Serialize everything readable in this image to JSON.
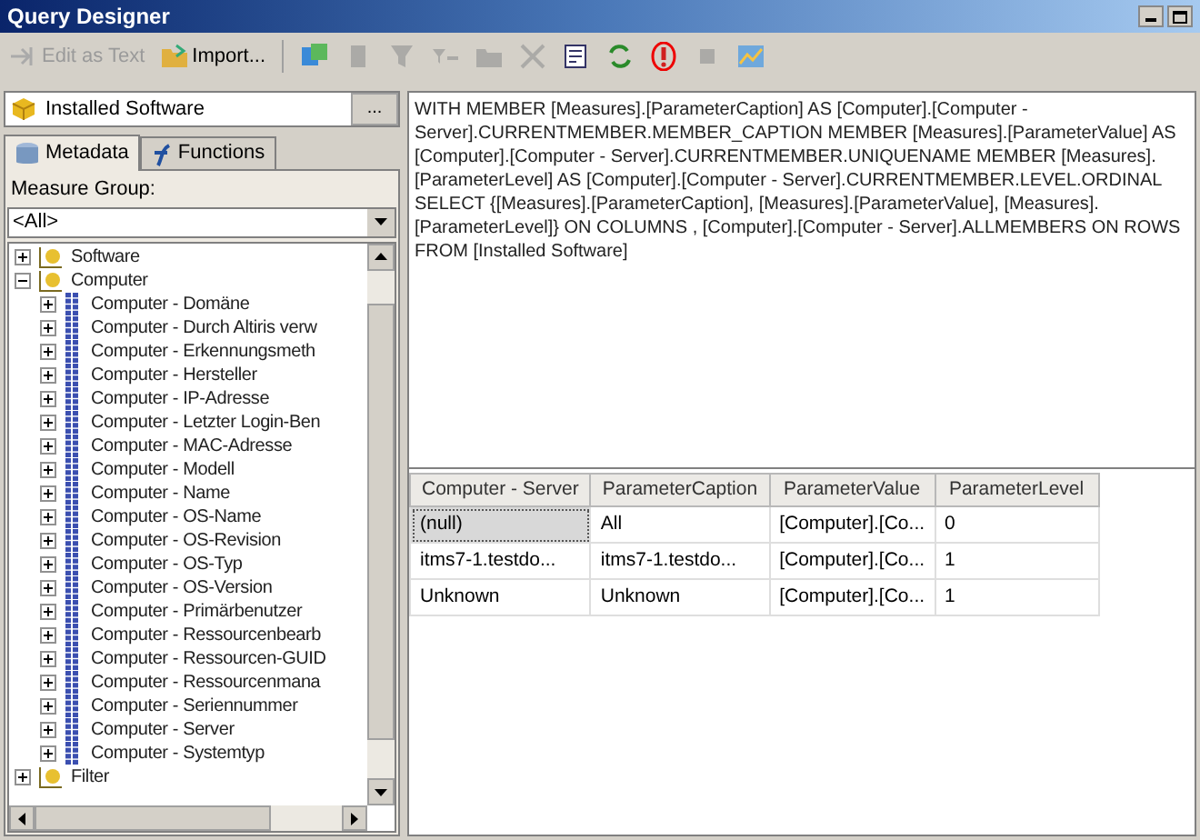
{
  "window": {
    "title": "Query Designer"
  },
  "toolbar": {
    "text_buttons": [
      {
        "kind": "edit",
        "label": "Edit as Text",
        "disabled": true
      },
      {
        "kind": "import",
        "label": "Import...",
        "disabled": false
      }
    ],
    "icon_buttons": [
      {
        "kind": "add-calc",
        "disabled": false
      },
      {
        "kind": "doc",
        "disabled": true
      },
      {
        "kind": "filter",
        "disabled": true
      },
      {
        "kind": "filter2",
        "disabled": true
      },
      {
        "kind": "folder",
        "disabled": true
      },
      {
        "kind": "delete",
        "disabled": true
      },
      {
        "kind": "params",
        "disabled": false
      },
      {
        "kind": "refresh",
        "disabled": false
      },
      {
        "kind": "run",
        "disabled": false
      },
      {
        "kind": "stop",
        "disabled": true
      },
      {
        "kind": "chart",
        "disabled": false
      }
    ]
  },
  "cube": {
    "name": "Installed Software",
    "button": "..."
  },
  "tabs": [
    {
      "label": "Metadata",
      "selected": true
    },
    {
      "label": "Functions",
      "selected": false
    }
  ],
  "measure_group": {
    "label": "Measure Group:",
    "value": "<All>"
  },
  "tree": [
    {
      "label": "Software",
      "kind": "dimension",
      "expanded": false
    },
    {
      "label": "Computer",
      "kind": "dimension",
      "expanded": true,
      "children": [
        {
          "label": "Computer - Domäne",
          "kind": "hierarchy",
          "expanded": false
        },
        {
          "label": "Computer - Durch Altiris verw",
          "kind": "hierarchy",
          "expanded": false
        },
        {
          "label": "Computer - Erkennungsmeth",
          "kind": "hierarchy",
          "expanded": false
        },
        {
          "label": "Computer - Hersteller",
          "kind": "hierarchy",
          "expanded": false
        },
        {
          "label": "Computer - IP-Adresse",
          "kind": "hierarchy",
          "expanded": false
        },
        {
          "label": "Computer - Letzter Login-Ben",
          "kind": "hierarchy",
          "expanded": false
        },
        {
          "label": "Computer - MAC-Adresse",
          "kind": "hierarchy",
          "expanded": false
        },
        {
          "label": "Computer - Modell",
          "kind": "hierarchy",
          "expanded": false
        },
        {
          "label": "Computer - Name",
          "kind": "hierarchy",
          "expanded": false
        },
        {
          "label": "Computer - OS-Name",
          "kind": "hierarchy",
          "expanded": false
        },
        {
          "label": "Computer - OS-Revision",
          "kind": "hierarchy",
          "expanded": false
        },
        {
          "label": "Computer - OS-Typ",
          "kind": "hierarchy",
          "expanded": false
        },
        {
          "label": "Computer - OS-Version",
          "kind": "hierarchy",
          "expanded": false
        },
        {
          "label": "Computer - Primärbenutzer",
          "kind": "hierarchy",
          "expanded": false
        },
        {
          "label": "Computer - Ressourcenbearb",
          "kind": "hierarchy",
          "expanded": false
        },
        {
          "label": "Computer - Ressourcen-GUID",
          "kind": "hierarchy",
          "expanded": false
        },
        {
          "label": "Computer - Ressourcenmana",
          "kind": "hierarchy",
          "expanded": false
        },
        {
          "label": "Computer - Seriennummer",
          "kind": "hierarchy",
          "expanded": false
        },
        {
          "label": "Computer - Server",
          "kind": "hierarchy",
          "expanded": false
        },
        {
          "label": "Computer - Systemtyp",
          "kind": "hierarchy",
          "expanded": false
        }
      ]
    },
    {
      "label": "Filter",
      "kind": "dimension",
      "expanded": false
    }
  ],
  "query": "WITH MEMBER [Measures].[ParameterCaption] AS [Computer].[Computer - Server].CURRENTMEMBER.MEMBER_CAPTION MEMBER [Measures].[ParameterValue] AS [Computer].[Computer - Server].CURRENTMEMBER.UNIQUENAME MEMBER [Measures].[ParameterLevel] AS [Computer].[Computer - Server].CURRENTMEMBER.LEVEL.ORDINAL SELECT {[Measures].[ParameterCaption], [Measures].[ParameterValue], [Measures].[ParameterLevel]} ON COLUMNS , [Computer].[Computer - Server].ALLMEMBERS ON ROWS FROM [Installed Software]",
  "results": {
    "columns": [
      "Computer - Server",
      "ParameterCaption",
      "ParameterValue",
      "ParameterLevel"
    ],
    "rows": [
      {
        "cells": [
          "(null)",
          "All",
          "[Computer].[Co...",
          "0"
        ],
        "selected": true
      },
      {
        "cells": [
          "itms7-1.testdo...",
          "itms7-1.testdo...",
          "[Computer].[Co...",
          "1"
        ],
        "selected": false
      },
      {
        "cells": [
          "Unknown",
          "Unknown",
          "[Computer].[Co...",
          "1"
        ],
        "selected": false
      }
    ]
  }
}
